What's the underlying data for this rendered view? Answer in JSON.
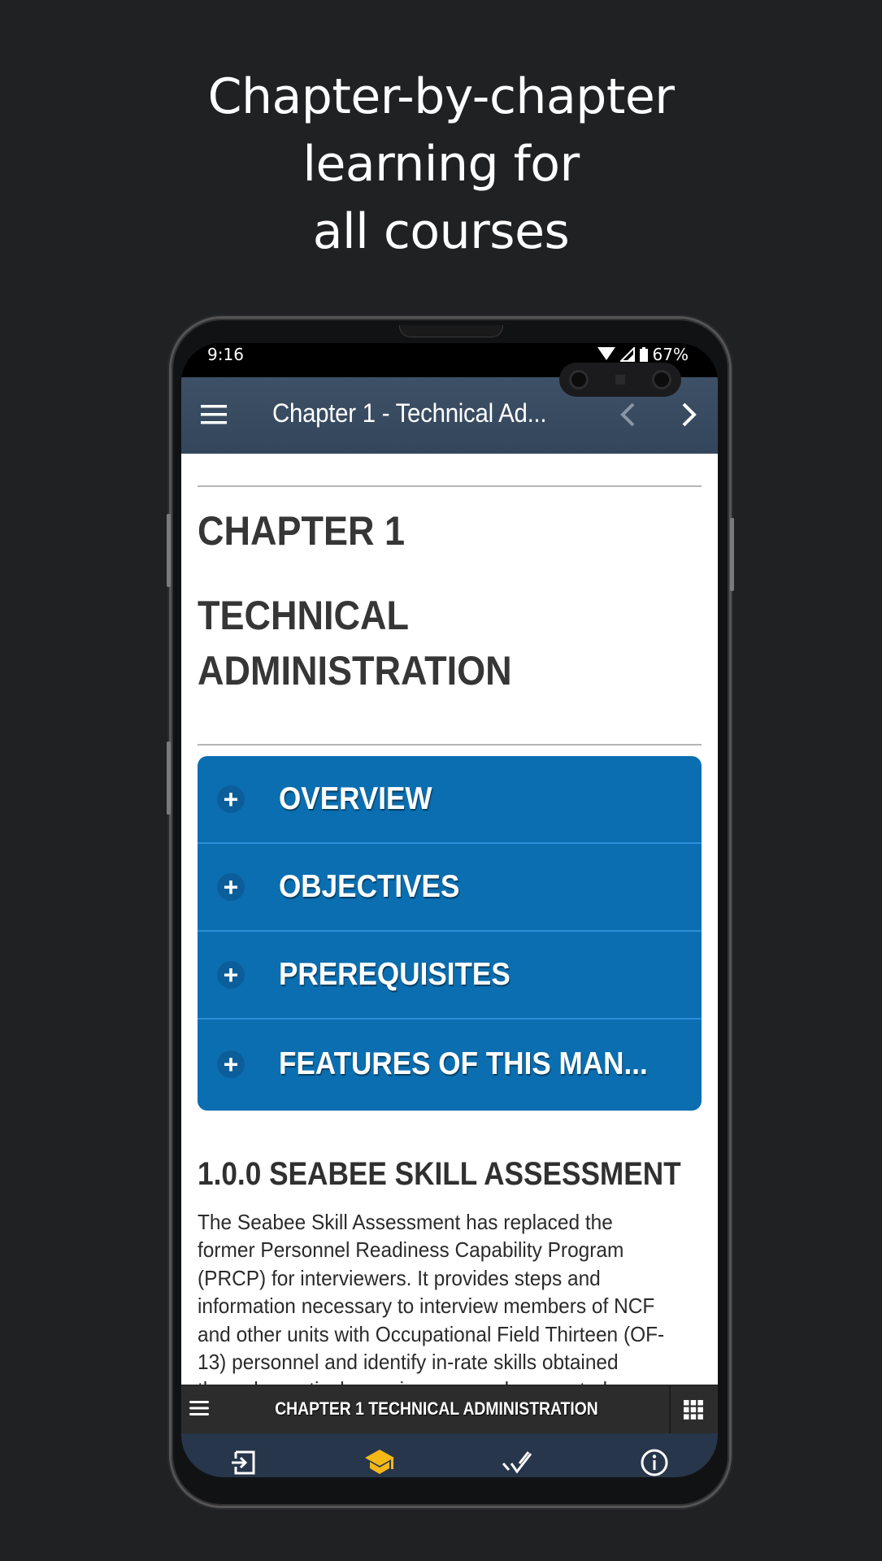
{
  "promo": {
    "headline_lines": [
      "Chapter-by-chapter",
      "learning for",
      "all courses"
    ]
  },
  "status_bar": {
    "time": "9:16",
    "battery": "67%",
    "icons": [
      "wifi-icon",
      "signal-icon",
      "battery-icon"
    ]
  },
  "app_bar": {
    "title": "Chapter 1 - Technical Ad...",
    "menu_icon": "hamburger-menu-icon",
    "prev_icon": "chevron-left-icon",
    "next_icon": "chevron-right-icon"
  },
  "content": {
    "chapter_heading": "CHAPTER 1",
    "chapter_title_lines": [
      "TECHNICAL",
      "ADMINISTRATION"
    ],
    "accordion": [
      {
        "label": "OVERVIEW",
        "icon": "plus-icon",
        "expanded": false
      },
      {
        "label": "OBJECTIVES",
        "icon": "plus-icon",
        "expanded": false
      },
      {
        "label": "PREREQUISITES",
        "icon": "plus-icon",
        "expanded": false
      },
      {
        "label": "FEATURES OF THIS MAN...",
        "icon": "plus-icon",
        "expanded": false
      }
    ],
    "section_title": "1.0.0 SEABEE SKILL ASSESSMENT",
    "section_body_lines": [
      "The Seabee Skill Assessment has replaced the",
      "former Personnel Readiness Capability Program",
      "(PRCP) for interviewers. It provides steps and",
      "information necessary to interview members of NCF",
      "and other units with Occupational Field Thirteen (OF-",
      "13) personnel and identify in-rate skills obtained",
      "through practical experience or undocumented"
    ]
  },
  "chapter_bar": {
    "title": "CHAPTER 1 TECHNICAL ADMINISTRATION",
    "menu_icon": "list-menu-icon",
    "grid_icon": "grid-icon"
  },
  "bottom_nav": {
    "items": [
      {
        "icon": "login-icon",
        "active": false
      },
      {
        "icon": "graduation-cap-icon",
        "active": true
      },
      {
        "icon": "double-check-icon",
        "active": false
      },
      {
        "icon": "info-icon",
        "active": false
      }
    ],
    "active_color": "#f5b817"
  },
  "colors": {
    "background": "#202123",
    "app_bar": "#3a4d63",
    "accordion": "#0a6eb0",
    "bottom_nav": "#27364a"
  }
}
